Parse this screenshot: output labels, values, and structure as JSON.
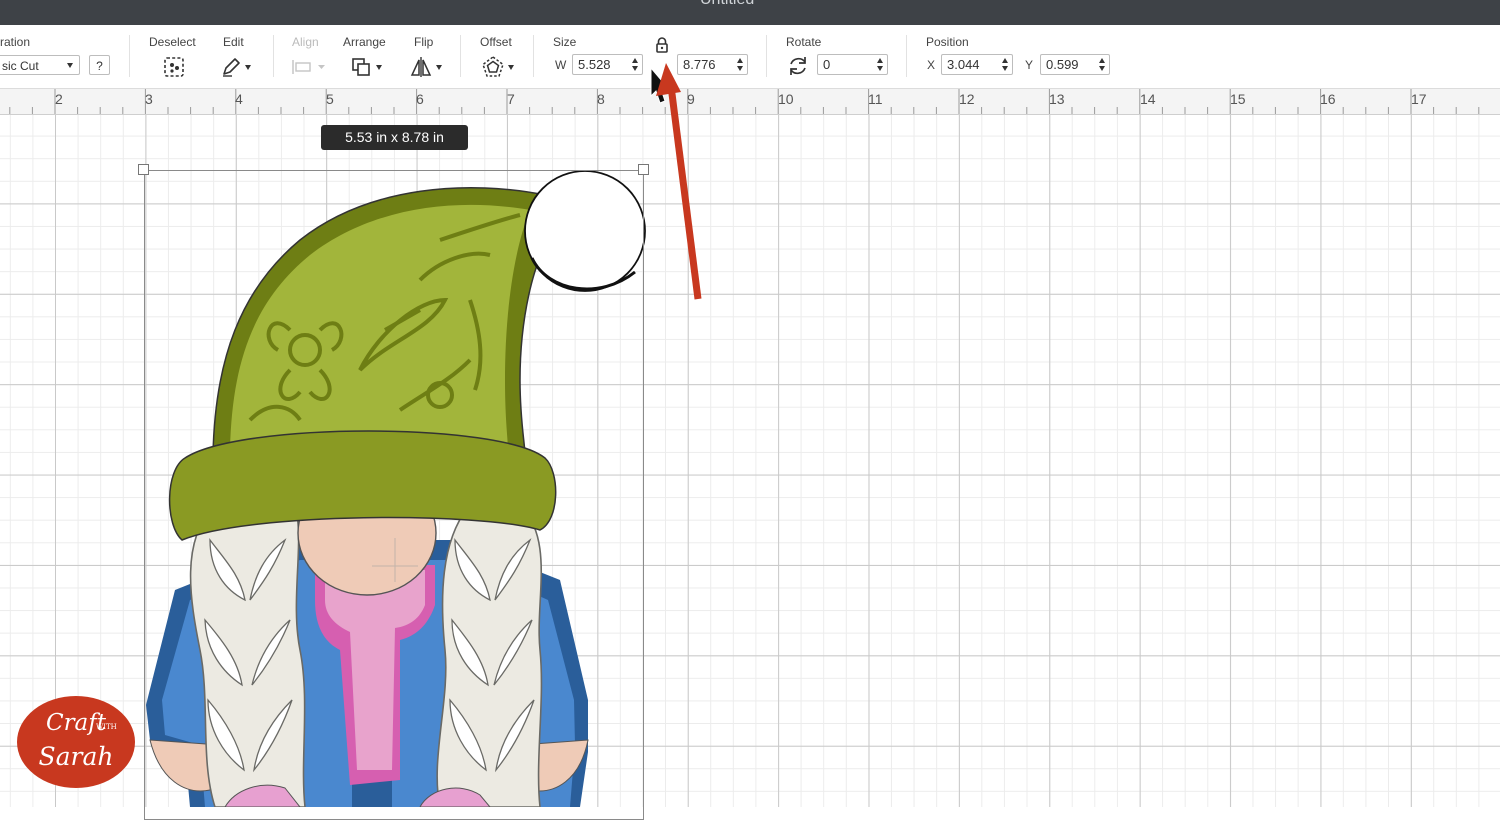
{
  "window": {
    "title": "Untitled"
  },
  "toolbar": {
    "operation": {
      "label": "ration",
      "value": "sic Cut",
      "help": "?"
    },
    "deselect": {
      "label": "Deselect"
    },
    "edit": {
      "label": "Edit"
    },
    "align": {
      "label": "Align"
    },
    "arrange": {
      "label": "Arrange"
    },
    "flip": {
      "label": "Flip"
    },
    "offset": {
      "label": "Offset"
    },
    "size": {
      "label": "Size",
      "w_label": "W",
      "w_value": "5.528",
      "h_value": "8.776"
    },
    "rotate": {
      "label": "Rotate",
      "value": "0"
    },
    "position": {
      "label": "Position",
      "x_label": "X",
      "x_value": "3.044",
      "y_label": "Y",
      "y_value": "0.599"
    }
  },
  "ruler": {
    "numbers": [
      "2",
      "3",
      "4",
      "5",
      "6",
      "7",
      "8",
      "9",
      "10",
      "11",
      "12",
      "13",
      "14",
      "15",
      "16",
      "17"
    ]
  },
  "canvas": {
    "size_tooltip": "5.53  in x 8.78  in",
    "design": "gnome-with-green-hat"
  },
  "watermark": {
    "line1": "Craft",
    "line2": "WITH",
    "line3": "Sarah"
  },
  "colors": {
    "hat": "#8a9a23",
    "hat_light": "#a2b53b",
    "annotation_arrow": "#c8381f",
    "coat": "#4a88cf",
    "scarf": "#e8a3cc",
    "skin": "#efcbb7",
    "logo": "#c8381f"
  }
}
